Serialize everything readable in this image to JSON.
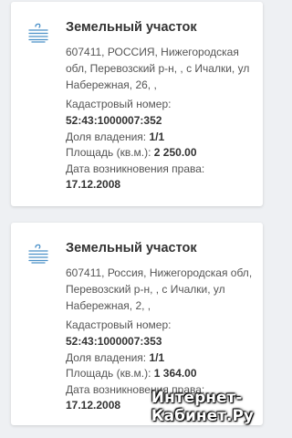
{
  "listings": [
    {
      "title": "Земельный участок",
      "address": "607411, РОССИЯ, Нижегородская обл, Перевозский р-н, , с Ичалки, ул Набережная, 26, ,",
      "cadastral_label": "Кадастровый номер:",
      "cadastral_value": "52:43:1000007:352",
      "share_label": "Доля владения:",
      "share_value": "1/1",
      "area_label": "Площадь (кв.м.):",
      "area_value": "2 250.00",
      "date_label": "Дата возникновения права:",
      "date_value": "17.12.2008"
    },
    {
      "title": "Земельный участок",
      "address": "607411, Россия, Нижегородская обл, Перевозский р-н, , с Ичалки, ул Набережная, 2, ,",
      "cadastral_label": "Кадастровый номер:",
      "cadastral_value": "52:43:1000007:353",
      "share_label": "Доля владения:",
      "share_value": "1/1",
      "area_label": "Площадь (кв.м.):",
      "area_value": "1 364.00",
      "date_label": "Дата возникновения права:",
      "date_value": "17.12.2008"
    }
  ],
  "watermark": {
    "line1": "Интернет-",
    "line2": "Кабинет.Ру"
  },
  "icon": {
    "name": "land-plot-icon",
    "color": "#4a90c8"
  }
}
